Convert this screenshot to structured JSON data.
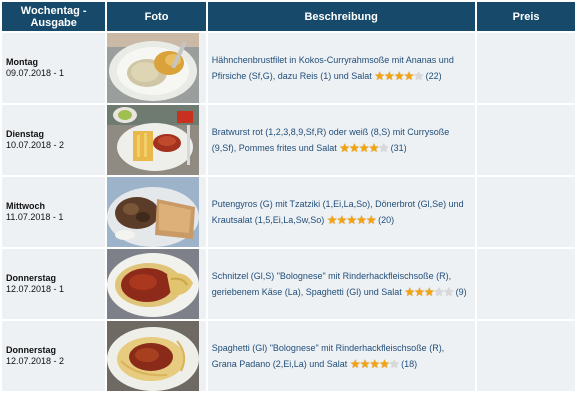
{
  "header": {
    "col_day": "Wochentag - Ausgabe",
    "col_photo": "Foto",
    "col_desc": "Beschreibung",
    "col_price": "Preis"
  },
  "rows": [
    {
      "day": "Montag",
      "date": "09.07.2018 - 1",
      "description": "Hähnchenbrustfilet in Kokos-Curryrahmsoße mit Ananas und Pfirsiche (Sf,G), dazu Reis (1) und Salat",
      "rating": 4,
      "count": "(22)",
      "photo_icon": "curry-rice-photo"
    },
    {
      "day": "Dienstag",
      "date": "10.07.2018 - 2",
      "description": "Bratwurst rot (1,2,3,8,9,Sf,R) oder weiß (8,S) mit Currysoße (9,Sf), Pommes frites und Salat",
      "rating": 4,
      "count": "(31)",
      "photo_icon": "bratwurst-fries-photo"
    },
    {
      "day": "Mittwoch",
      "date": "11.07.2018 - 1",
      "description": "Putengyros (G) mit Tzatziki (1,Ei,La,So), Dönerbrot (Gl,Se) und Krautsalat (1,5,Ei,La,Sw,So)",
      "rating": 5,
      "count": "(20)",
      "photo_icon": "gyros-bread-photo"
    },
    {
      "day": "Donnerstag",
      "date": "12.07.2018 - 1",
      "description": "Schnitzel (Gl,S) \"Bolognese\" mit Rinderhackfleischsoße (R), geriebenem Käse (La), Spaghetti (Gl) und Salat",
      "rating": 3,
      "count": "(9)",
      "photo_icon": "schnitzel-bolognese-photo"
    },
    {
      "day": "Donnerstag",
      "date": "12.07.2018 - 2",
      "description": "Spaghetti (Gl) \"Bolognese\" mit Rinderhackfleischsoße (R), Grana Padano (2,Ei,La) und Salat",
      "rating": 4,
      "count": "(18)",
      "photo_icon": "spaghetti-bolognese-photo"
    }
  ],
  "colors": {
    "header_bg": "#174a6a",
    "row_bg": "#eef1f4",
    "star": "#f2a410",
    "link_text": "#1f4d79"
  }
}
